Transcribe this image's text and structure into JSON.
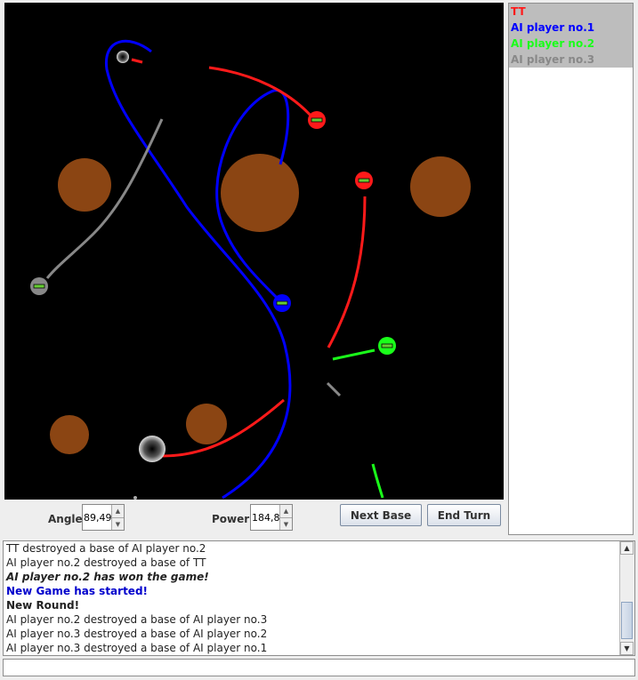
{
  "players": [
    {
      "name": "TT",
      "color": "#ff1a1a"
    },
    {
      "name": "AI player no.1",
      "color": "#0000ff"
    },
    {
      "name": "AI player no.2",
      "color": "#1aff1a"
    },
    {
      "name": "AI player no.3",
      "color": "#888888"
    }
  ],
  "controls": {
    "angle_label": "Angle",
    "angle_value": "89,49",
    "power_label": "Power",
    "power_value": "184,8",
    "next_base_label": "Next Base",
    "end_turn_label": "End Turn"
  },
  "log": [
    {
      "text": "TT destroyed a base of AI player no.2",
      "style": ""
    },
    {
      "text": "AI player no.2 destroyed a base of TT",
      "style": ""
    },
    {
      "text": "AI player no.2 has won the game!",
      "style": "bi"
    },
    {
      "text": "New Game has started!",
      "style": "blue"
    },
    {
      "text": "New Round!",
      "style": "b"
    },
    {
      "text": "AI player no.2 destroyed a base of AI player no.3",
      "style": ""
    },
    {
      "text": "AI player no.3 destroyed a base of AI player no.2",
      "style": ""
    },
    {
      "text": "AI player no.3 destroyed a base of AI player no.1",
      "style": ""
    }
  ],
  "command_input": {
    "value": ""
  },
  "colors": {
    "planet": "#8b4513",
    "space": "#000000"
  },
  "icons": {
    "spin_up": "triangle-up-icon",
    "spin_down": "triangle-down-icon",
    "scroll_up": "scroll-up-icon",
    "scroll_down": "scroll-down-icon"
  }
}
